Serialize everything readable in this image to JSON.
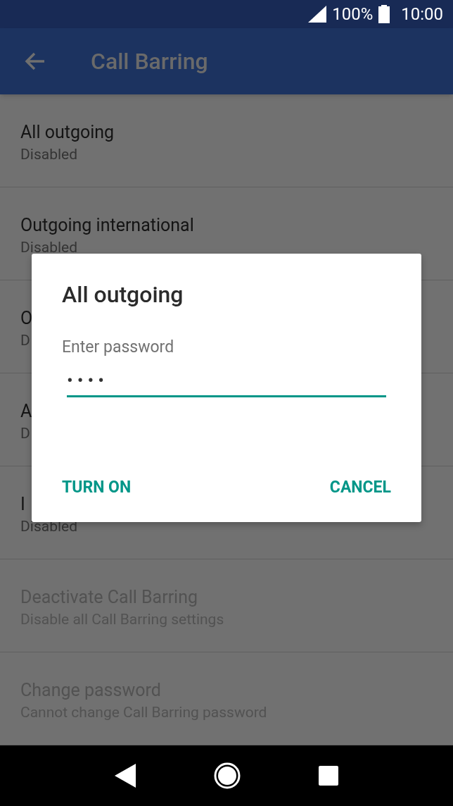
{
  "status_bar": {
    "battery": "100%",
    "time": "10:00"
  },
  "app_bar": {
    "title": "Call Barring"
  },
  "list": [
    {
      "title": "All outgoing",
      "subtitle": "Disabled",
      "disabled": false
    },
    {
      "title": "Outgoing international",
      "subtitle": "Disabled",
      "disabled": false
    },
    {
      "title": "O",
      "subtitle": "D",
      "disabled": false
    },
    {
      "title": "A",
      "subtitle": "D",
      "disabled": false
    },
    {
      "title": "I",
      "subtitle": "Disabled",
      "disabled": false
    },
    {
      "title": "Deactivate Call Barring",
      "subtitle": "Disable all Call Barring settings",
      "disabled": true
    },
    {
      "title": "Change password",
      "subtitle": "Cannot change Call Barring password",
      "disabled": true
    }
  ],
  "dialog": {
    "title": "All outgoing",
    "label": "Enter password",
    "value": "••••",
    "buttons": [
      "TURN ON",
      "CANCEL"
    ]
  }
}
